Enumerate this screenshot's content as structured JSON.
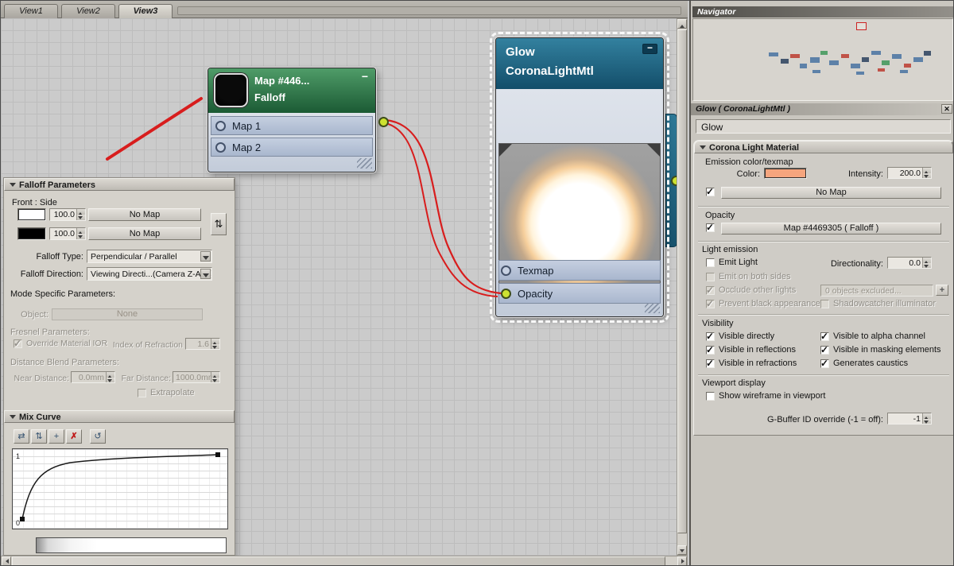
{
  "tabs": {
    "items": [
      {
        "label": "View1"
      },
      {
        "label": "View2"
      },
      {
        "label": "View3"
      }
    ]
  },
  "nodes": {
    "falloff": {
      "title": "Map #446...",
      "minimize": "−",
      "subtitle": "Falloff",
      "slots": [
        "Map 1",
        "Map 2"
      ]
    },
    "glow": {
      "title": "Glow",
      "minimize": "−",
      "subtitle": "CoronaLightMtl",
      "slots": [
        "Texmap",
        "Opacity"
      ]
    }
  },
  "falloff_panel": {
    "title": "Falloff Parameters",
    "front_side_label": "Front : Side",
    "side_rows": [
      {
        "amount": "100.0",
        "map_button": "No Map",
        "color": "#ffffff"
      },
      {
        "amount": "100.0",
        "map_button": "No Map",
        "color": "#000000"
      }
    ],
    "swap_icon": "⇅",
    "falloff_type_label": "Falloff Type:",
    "falloff_type_value": "Perpendicular / Parallel",
    "falloff_direction_label": "Falloff Direction:",
    "falloff_direction_value": "Viewing Directi...(Camera Z-Axis)",
    "mode_specific_label": "Mode Specific Parameters:",
    "object_label": "Object:",
    "object_value": "None",
    "fresnel_label": "Fresnel Parameters:",
    "override_ior_label": "Override Material IOR",
    "override_ior_checked": true,
    "ior_label": "Index of Refraction",
    "ior_value": "1.6",
    "distance_blend_label": "Distance Blend Parameters:",
    "near_label": "Near Distance:",
    "near_value": "0.0mm",
    "far_label": "Far Distance:",
    "far_value": "1000.0mm",
    "extrapolate_label": "Extrapolate",
    "extrapolate_checked": false,
    "mix_curve_title": "Mix Curve",
    "curve_toolbar": [
      {
        "glyph": "⇄"
      },
      {
        "glyph": "⇅"
      },
      {
        "glyph": "+"
      },
      {
        "glyph": "✗"
      },
      {
        "glyph": "↺"
      }
    ],
    "curve_axis_max": "1",
    "curve_axis_min": "0"
  },
  "navigator": {
    "title": "Navigator"
  },
  "material_panel": {
    "header_title": "Glow ( CoronaLightMtl )",
    "close_icon": "✕",
    "name_value": "Glow",
    "rollout_title": "Corona Light Material",
    "emission_section_label": "Emission color/texmap",
    "color_label": "Color:",
    "color_value": "#f5a57e",
    "intensity_label": "Intensity:",
    "intensity_value": "200.0",
    "emission_map_checked": true,
    "emission_map_button": "No Map",
    "opacity_label": "Opacity",
    "opacity_map_checked": true,
    "opacity_map_button": "Map #4469305  ( Falloff )",
    "light_emission_label": "Light emission",
    "emit_light_label": "Emit Light",
    "emit_light_checked": false,
    "directionality_label": "Directionality:",
    "directionality_value": "0.0",
    "emit_both_sides_label": "Emit on both sides",
    "emit_both_sides_checked": false,
    "occlude_label": "Occlude other lights",
    "occlude_checked": true,
    "objects_excluded_value": "0 objects excluded...",
    "add_exclude_label": "+",
    "prevent_black_label": "Prevent black appearance",
    "prevent_black_checked": true,
    "shadowcatcher_label": "Shadowcatcher illuminator",
    "shadowcatcher_checked": false,
    "visibility_label": "Visibility",
    "visibility_items": [
      {
        "label": "Visible directly",
        "checked": true
      },
      {
        "label": "Visible to alpha channel",
        "checked": true
      },
      {
        "label": "Visible in reflections",
        "checked": true
      },
      {
        "label": "Visible in masking elements",
        "checked": true
      },
      {
        "label": "Visible in refractions",
        "checked": true
      },
      {
        "label": "Generates caustics",
        "checked": true
      }
    ],
    "viewport_display_label": "Viewport display",
    "show_wireframe_label": "Show wireframe in viewport",
    "show_wireframe_checked": false,
    "gbuffer_label": "G-Buffer ID override (-1 = off):",
    "gbuffer_value": "-1"
  },
  "colors": {
    "accent_wire": "#d81d1d",
    "node_green": "#2e7d4f",
    "node_teal": "#1f6787",
    "socket_connected": "#cde231",
    "emission_swatch": "#f5a57e"
  }
}
